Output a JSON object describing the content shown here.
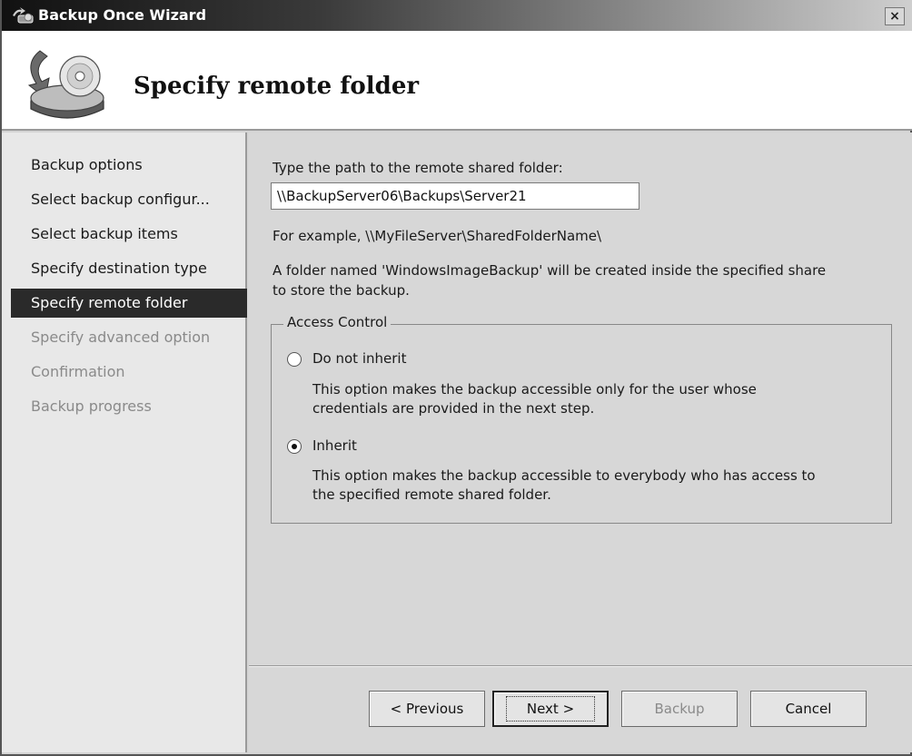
{
  "window": {
    "title": "Backup Once Wizard",
    "close_glyph": "×"
  },
  "header": {
    "title": "Specify remote folder",
    "icon": "backup-disk-icon"
  },
  "sidebar": {
    "items": [
      {
        "label": "Backup options",
        "state": "normal"
      },
      {
        "label": "Select backup configur...",
        "state": "normal"
      },
      {
        "label": "Select backup items",
        "state": "normal"
      },
      {
        "label": "Specify destination type",
        "state": "normal"
      },
      {
        "label": "Specify remote folder",
        "state": "active"
      },
      {
        "label": "Specify advanced option",
        "state": "disabled"
      },
      {
        "label": "Confirmation",
        "state": "disabled"
      },
      {
        "label": "Backup progress",
        "state": "disabled"
      }
    ]
  },
  "main": {
    "path_prompt": "Type the path to the remote shared folder:",
    "path_value": "\\\\BackupServer06\\Backups\\Server21",
    "example_text": "For example, \\\\MyFileServer\\SharedFolderName\\",
    "info_line1": "A folder named 'WindowsImageBackup' will be created inside the specified share",
    "info_line2": "to store the backup.",
    "access_control": {
      "legend": "Access Control",
      "options": [
        {
          "label": "Do not inherit",
          "selected": false,
          "desc_line1": "This option makes the backup accessible only for the user whose",
          "desc_line2": "credentials are provided in the next step."
        },
        {
          "label": "Inherit",
          "selected": true,
          "desc_line1": "This option makes the backup accessible to everybody who has access to",
          "desc_line2": "the specified remote shared folder."
        }
      ]
    }
  },
  "footer": {
    "previous_label": "< Previous",
    "next_label": "Next >",
    "backup_label": "Backup",
    "cancel_label": "Cancel"
  }
}
